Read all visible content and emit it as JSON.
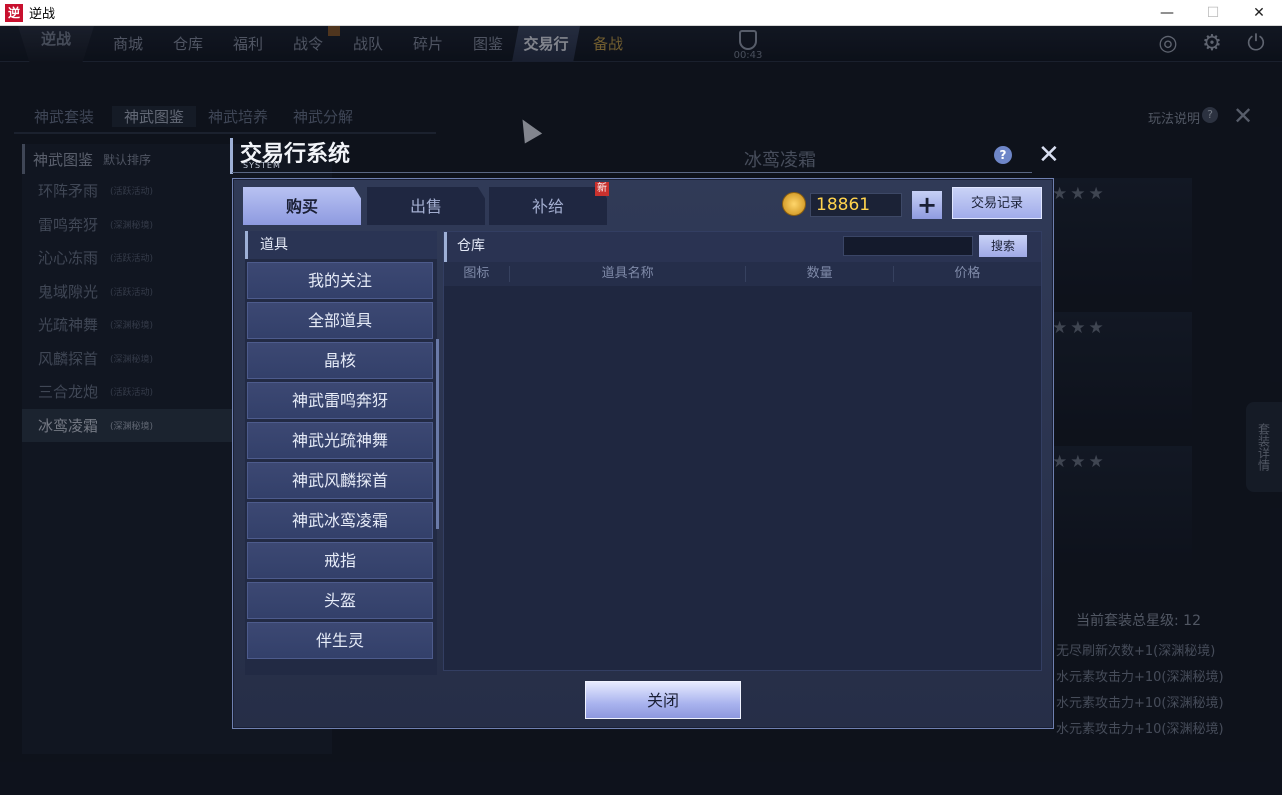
{
  "window": {
    "title": "逆战",
    "app_icon": "逆"
  },
  "topnav": {
    "logo": "逆战",
    "items": [
      "商城",
      "仓库",
      "福利",
      "战令",
      "战队",
      "碎片",
      "图鉴",
      "交易行",
      "备战"
    ],
    "active": "交易行",
    "timer": "00:43"
  },
  "background": {
    "tabs": [
      "神武套装",
      "神武图鉴",
      "神武培养",
      "神武分解"
    ],
    "active_tab": "神武图鉴",
    "help_label": "玩法说明",
    "list_header": "神武图鉴",
    "list_sort": "默认排序",
    "list": [
      {
        "name": "环阵矛雨",
        "tag": "(活跃活动)"
      },
      {
        "name": "雷鸣奔犽",
        "tag": "(深渊秘境)"
      },
      {
        "name": "沁心冻雨",
        "tag": "(活跃活动)"
      },
      {
        "name": "鬼域隙光",
        "tag": "(活跃活动)"
      },
      {
        "name": "光疏神舞",
        "tag": "(深渊秘境)"
      },
      {
        "name": "风麟探首",
        "tag": "(深渊秘境)"
      },
      {
        "name": "三合龙炮",
        "tag": "(活跃活动)"
      },
      {
        "name": "冰鸾凌霜",
        "tag": "(深渊秘境)"
      }
    ],
    "detail_title": "冰鸾凌霜",
    "stars": "★★★",
    "total_stars_label": "当前套装总星级: 12",
    "bonuses": [
      "无尽刷新次数+1(深渊秘境)",
      "水元素攻击力+10(深渊秘境)",
      "水元素攻击力+10(深渊秘境)",
      "水元素攻击力+10(深渊秘境)"
    ],
    "side_tab": "套装详情"
  },
  "dialog": {
    "title": "交易行系统",
    "subtitle": "SYSTEM",
    "tabs": [
      "购买",
      "出售",
      "补给"
    ],
    "active_tab": "购买",
    "new_badge": "新",
    "currency": "18861",
    "plus_label": "+",
    "record_button": "交易记录",
    "left_header": "道具",
    "categories": [
      "我的关注",
      "全部道具",
      "晶核",
      "神武雷鸣奔犽",
      "神武光疏神舞",
      "神武风麟探首",
      "神武冰鸾凌霜",
      "戒指",
      "头盔",
      "伴生灵"
    ],
    "right_header": "仓库",
    "search_button": "搜索",
    "search_value": "",
    "columns": [
      "图标",
      "道具名称",
      "数量",
      "价格"
    ],
    "close_button": "关闭"
  }
}
